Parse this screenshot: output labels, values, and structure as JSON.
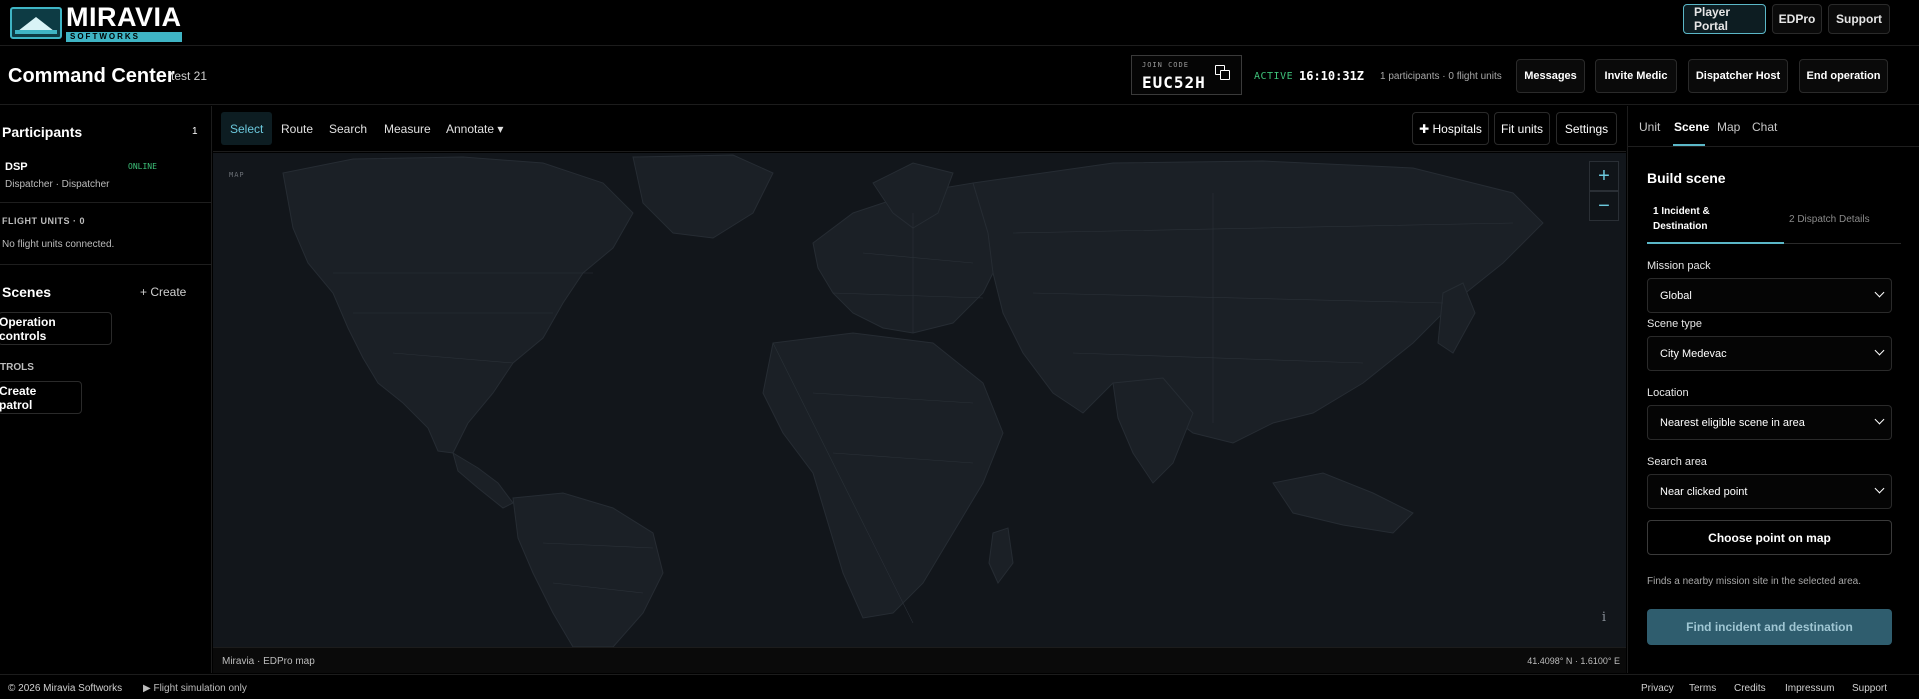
{
  "brand": {
    "name": "MIRAVIA",
    "sub": "SOFTWORKS"
  },
  "topnav": {
    "player_portal": "Player Portal",
    "edpro": "EDPro",
    "support": "Support"
  },
  "header": {
    "title": "Command Center",
    "session": "test 21",
    "join_code_label": "JOIN CODE",
    "join_code": "EUC52H",
    "status": "ACTIVE",
    "clock": "16:10:31Z",
    "counts": "1 participants · 0 flight units",
    "buttons": {
      "messages": "Messages",
      "invite_medic": "Invite Medic",
      "dispatcher_host": "Dispatcher Host",
      "end_operation": "End operation"
    }
  },
  "sidebar": {
    "participants_title": "Participants",
    "participants_count": "1",
    "participant": {
      "code": "DSP",
      "status": "ONLINE",
      "role": "Dispatcher · Dispatcher"
    },
    "flight_units_title": "FLIGHT UNITS · 0",
    "flight_units_empty": "No flight units connected.",
    "scenes_title": "Scenes",
    "create_label": "+ Create",
    "operation_controls": "Operation controls",
    "controls_label": "TROLS",
    "create_patrol": "Create patrol"
  },
  "toolbar": {
    "tools": {
      "select": "Select",
      "route": "Route",
      "search": "Search",
      "measure": "Measure",
      "annotate": "Annotate ▾"
    },
    "hospitals": "✚ Hospitals",
    "fit_units": "Fit units",
    "settings": "Settings"
  },
  "map": {
    "label": "MAP",
    "zoom_in": "+",
    "zoom_out": "−",
    "info": "i",
    "attribution": "Miravia · EDPro map",
    "coords": "41.4098° N · 1.6100° E"
  },
  "panel": {
    "tabs": {
      "unit": "Unit",
      "scene": "Scene",
      "map": "Map",
      "chat": "Chat"
    },
    "title": "Build scene",
    "step1": "1 Incident & Destination",
    "step2": "2 Dispatch Details",
    "mission_pack_label": "Mission pack",
    "mission_pack_value": "Global",
    "scene_type_label": "Scene type",
    "scene_type_value": "City Medevac",
    "location_label": "Location",
    "location_value": "Nearest eligible scene in area",
    "search_area_label": "Search area",
    "search_area_value": "Near clicked point",
    "choose_point": "Choose point on map",
    "hint": "Finds a nearby mission site in the selected area.",
    "find_button": "Find incident and destination"
  },
  "footer": {
    "copyright": "© 2026 Miravia Softworks",
    "sim": "▶ Flight simulation only",
    "links": {
      "privacy": "Privacy",
      "terms": "Terms",
      "credits": "Credits",
      "impressum": "Impressum",
      "support": "Support"
    }
  },
  "colors": {
    "accent": "#5bb7c7",
    "active_green": "#3ec27a",
    "map_bg": "#12161b",
    "land": "#1b2026",
    "border": "#2a2a2a"
  }
}
